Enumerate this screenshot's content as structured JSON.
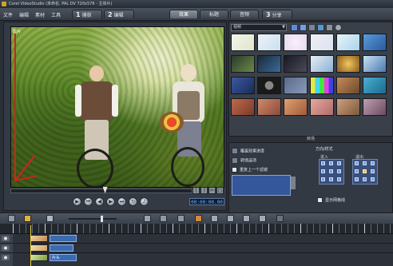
{
  "window": {
    "title": "Corel VideoStudio (未命名, PAL DV 720x576 - 主体片)"
  },
  "menu": {
    "items": [
      "文件",
      "编辑",
      "素材",
      "工具"
    ]
  },
  "steps": [
    {
      "num": "1",
      "label": "捕获"
    },
    {
      "num": "2",
      "label": "编辑"
    },
    {
      "num": "",
      "label": "效果",
      "active": true
    },
    {
      "num": "",
      "label": "标题"
    },
    {
      "num": "",
      "label": "音频"
    },
    {
      "num": "3",
      "label": "分享"
    }
  ],
  "preview": {
    "clip_label": "影片",
    "timecode": "00:00:00.00",
    "scrub_progress": 0.52,
    "transport_icons": [
      "play-icon",
      "home-icon",
      "prev-frame-icon",
      "next-frame-icon",
      "end-icon",
      "repeat-icon",
      "volume-icon"
    ]
  },
  "library": {
    "category": "视频",
    "caption": "转场"
  },
  "options": {
    "row1": "覆盖效果进度",
    "row2": "转场选项",
    "row3": "重复上一个滤镜",
    "direction_title": "方向/样式",
    "dir_in": "进入",
    "dir_out": "退出",
    "bottom_check": "显示网格线"
  },
  "tracks": {
    "title_clip": "片头"
  }
}
